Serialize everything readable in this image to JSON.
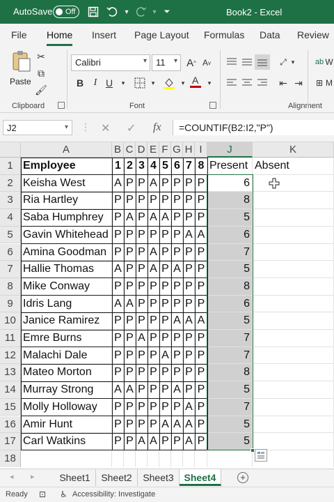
{
  "titlebar": {
    "autosave_label": "AutoSave",
    "autosave_state": "Off",
    "window_title": "Book2  -  Excel"
  },
  "ribbon_tabs": [
    "File",
    "Home",
    "Insert",
    "Page Layout",
    "Formulas",
    "Data",
    "Review"
  ],
  "ribbon_tabs_active": "Home",
  "ribbon": {
    "paste_label": "Paste",
    "font_name": "Calibri",
    "font_size": "11",
    "group_clipboard": "Clipboard",
    "group_font": "Font",
    "group_alignment": "Alignment",
    "font_color": "#c00000",
    "highlight_color": "#ffff00"
  },
  "formula_bar": {
    "name_box": "J2",
    "formula": "=COUNTIF(B2:I2,\"P\")"
  },
  "grid": {
    "columns": [
      "A",
      "B",
      "C",
      "D",
      "E",
      "F",
      "G",
      "H",
      "I",
      "J",
      "K"
    ],
    "selected_column": "J",
    "header_row": {
      "employee": "Employee",
      "days": [
        "1",
        "2",
        "3",
        "4",
        "5",
        "6",
        "7",
        "8"
      ],
      "present": "Present",
      "absent": "Absent"
    },
    "rows": [
      {
        "num": "2",
        "name": "Keisha West",
        "days": [
          "A",
          "P",
          "P",
          "A",
          "P",
          "P",
          "P",
          "P"
        ],
        "present": "6"
      },
      {
        "num": "3",
        "name": "Ria Hartley",
        "days": [
          "P",
          "P",
          "P",
          "P",
          "P",
          "P",
          "P",
          "P"
        ],
        "present": "8"
      },
      {
        "num": "4",
        "name": "Saba Humphrey",
        "days": [
          "P",
          "A",
          "P",
          "A",
          "A",
          "P",
          "P",
          "P"
        ],
        "present": "5"
      },
      {
        "num": "5",
        "name": "Gavin Whitehead",
        "days": [
          "P",
          "P",
          "P",
          "P",
          "P",
          "P",
          "A",
          "A"
        ],
        "present": "6"
      },
      {
        "num": "6",
        "name": "Amina Goodman",
        "days": [
          "P",
          "P",
          "P",
          "A",
          "P",
          "P",
          "P",
          "P"
        ],
        "present": "7"
      },
      {
        "num": "7",
        "name": "Hallie Thomas",
        "days": [
          "A",
          "P",
          "P",
          "A",
          "P",
          "A",
          "P",
          "P"
        ],
        "present": "5"
      },
      {
        "num": "8",
        "name": "Mike Conway",
        "days": [
          "P",
          "P",
          "P",
          "P",
          "P",
          "P",
          "P",
          "P"
        ],
        "present": "8"
      },
      {
        "num": "9",
        "name": "Idris Lang",
        "days": [
          "A",
          "A",
          "P",
          "P",
          "P",
          "P",
          "P",
          "P"
        ],
        "present": "6"
      },
      {
        "num": "10",
        "name": "Janice Ramirez",
        "days": [
          "P",
          "P",
          "P",
          "P",
          "P",
          "A",
          "A",
          "A"
        ],
        "present": "5"
      },
      {
        "num": "11",
        "name": "Emre Burns",
        "days": [
          "P",
          "P",
          "A",
          "P",
          "P",
          "P",
          "P",
          "P"
        ],
        "present": "7"
      },
      {
        "num": "12",
        "name": "Malachi Dale",
        "days": [
          "P",
          "P",
          "P",
          "P",
          "A",
          "P",
          "P",
          "P"
        ],
        "present": "7"
      },
      {
        "num": "13",
        "name": "Mateo Morton",
        "days": [
          "P",
          "P",
          "P",
          "P",
          "P",
          "P",
          "P",
          "P"
        ],
        "present": "8"
      },
      {
        "num": "14",
        "name": "Murray Strong",
        "days": [
          "A",
          "A",
          "P",
          "P",
          "P",
          "A",
          "P",
          "P"
        ],
        "present": "5"
      },
      {
        "num": "15",
        "name": "Molly Holloway",
        "days": [
          "P",
          "P",
          "P",
          "P",
          "P",
          "P",
          "A",
          "P"
        ],
        "present": "7"
      },
      {
        "num": "16",
        "name": "Amir Hunt",
        "days": [
          "P",
          "P",
          "P",
          "P",
          "A",
          "A",
          "A",
          "P"
        ],
        "present": "5"
      },
      {
        "num": "17",
        "name": "Carl Watkins",
        "days": [
          "P",
          "P",
          "A",
          "A",
          "P",
          "P",
          "A",
          "P"
        ],
        "present": "5"
      }
    ],
    "empty_row_num": "18"
  },
  "sheet_tabs": [
    "Sheet1",
    "Sheet2",
    "Sheet3",
    "Sheet4"
  ],
  "active_sheet": "Sheet4",
  "status_bar": {
    "ready": "Ready",
    "accessibility": "Accessibility: Investigate"
  },
  "colors": {
    "accent": "#1e7145",
    "selection_fill": "#d0d0d0"
  }
}
